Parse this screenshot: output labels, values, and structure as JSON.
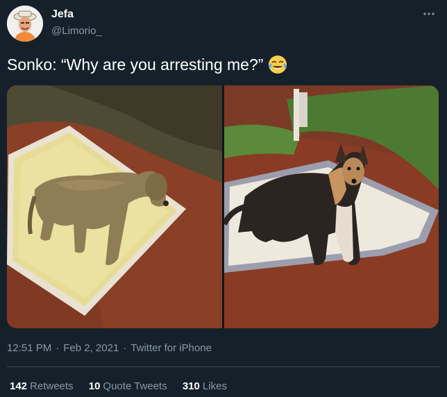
{
  "author": {
    "display_name": "Jefa",
    "handle": "@Limorio_",
    "avatar_icon": "avatar-portrait"
  },
  "tweet": {
    "text": "Sonko: “Why are you arresting me?”",
    "emoji_icon": "face-with-tears-of-joy-icon"
  },
  "media": {
    "images": [
      {
        "name": "dog-lying-on-grain-sack"
      },
      {
        "name": "dog-posing-on-grain-sack"
      }
    ]
  },
  "meta": {
    "time": "12:51 PM",
    "date": "Feb 2, 2021",
    "separator": "·",
    "source": "Twitter for iPhone"
  },
  "stats": {
    "retweets_count": "142",
    "retweets_label": "Retweets",
    "quote_count": "10",
    "quote_label": "Quote Tweets",
    "likes_count": "310",
    "likes_label": "Likes"
  },
  "colors": {
    "background": "#15202b",
    "secondary_text": "#8899a6",
    "divider": "#38444d"
  }
}
